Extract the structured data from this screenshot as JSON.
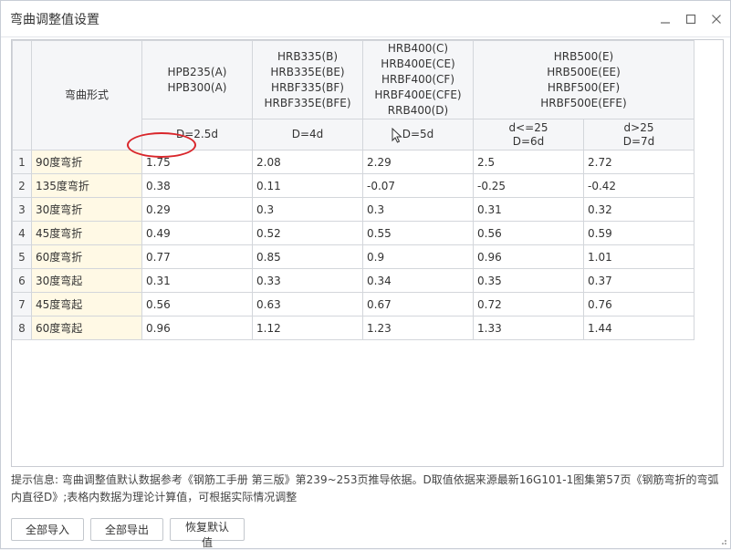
{
  "window": {
    "title": "弯曲调整值设置",
    "minimize_glyph": "—",
    "maximize_glyph": "□",
    "close_glyph": "✕"
  },
  "table": {
    "corner_label": "弯曲形式",
    "groups": [
      {
        "lines": [
          "HPB235(A)",
          "HPB300(A)"
        ],
        "sub": [
          "D=2.5d"
        ]
      },
      {
        "lines": [
          "HRB335(B)",
          "HRB335E(BE)",
          "HRBF335(BF)",
          "HRBF335E(BFE)"
        ],
        "sub": [
          "D=4d"
        ]
      },
      {
        "lines": [
          "HRB400(C)",
          "HRB400E(CE)",
          "HRBF400(CF)",
          "HRBF400E(CFE)",
          "RRB400(D)"
        ],
        "sub": [
          "D=5d"
        ]
      },
      {
        "lines": [
          "HRB500(E)",
          "HRB500E(EE)",
          "HRBF500(EF)",
          "HRBF500E(EFE)"
        ],
        "sub": [
          "d<=25\nD=6d",
          "d>25\nD=7d"
        ]
      }
    ],
    "rows": [
      {
        "num": "1",
        "name": "90度弯折",
        "values": [
          "1.75",
          "2.08",
          "2.29",
          "2.5",
          "2.72"
        ]
      },
      {
        "num": "2",
        "name": "135度弯折",
        "values": [
          "0.38",
          "0.11",
          "-0.07",
          "-0.25",
          "-0.42"
        ]
      },
      {
        "num": "3",
        "name": "30度弯折",
        "values": [
          "0.29",
          "0.3",
          "0.3",
          "0.31",
          "0.32"
        ]
      },
      {
        "num": "4",
        "name": "45度弯折",
        "values": [
          "0.49",
          "0.52",
          "0.55",
          "0.56",
          "0.59"
        ]
      },
      {
        "num": "5",
        "name": "60度弯折",
        "values": [
          "0.77",
          "0.85",
          "0.9",
          "0.96",
          "1.01"
        ]
      },
      {
        "num": "6",
        "name": "30度弯起",
        "values": [
          "0.31",
          "0.33",
          "0.34",
          "0.35",
          "0.37"
        ]
      },
      {
        "num": "7",
        "name": "45度弯起",
        "values": [
          "0.56",
          "0.63",
          "0.67",
          "0.72",
          "0.76"
        ]
      },
      {
        "num": "8",
        "name": "60度弯起",
        "values": [
          "0.96",
          "1.12",
          "1.23",
          "1.33",
          "1.44"
        ]
      }
    ]
  },
  "hint": {
    "text": "提示信息: 弯曲调整值默认数据参考《钢筋工手册 第三版》第239~253页推导依据。D取值依据来源最新16G101-1图集第57页《钢筋弯折的弯弧内直径D》;表格内数据为理论计算值，可根据实际情况调整"
  },
  "buttons": {
    "import_all": "全部导入",
    "export_all": "全部导出",
    "restore_default": "恢复默认值"
  },
  "colors": {
    "annotation_circle": "#d9262b",
    "name_column_bg": "#fff9e5"
  }
}
